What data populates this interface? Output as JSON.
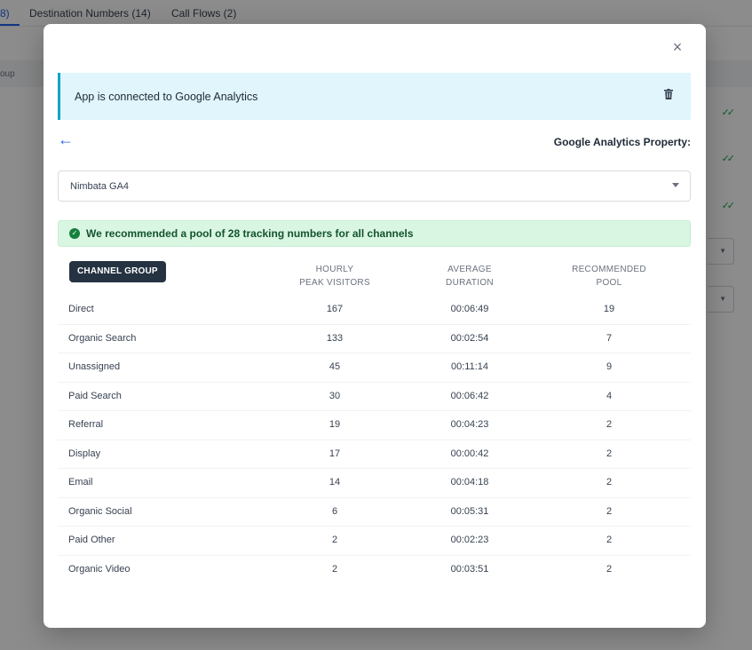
{
  "background": {
    "tabs": [
      {
        "label": "8)"
      },
      {
        "label": "Destination Numbers (14)"
      },
      {
        "label": "Call Flows (2)"
      }
    ],
    "column_fragment": "oup"
  },
  "modal": {
    "close_label": "×",
    "alert_text": "App is connected to Google Analytics",
    "back_label": "←",
    "property_label": "Google Analytics Property:",
    "property_value": "Nimbata GA4",
    "recommendation_text": "We recommended a pool of 28 tracking numbers for all channels",
    "table": {
      "headers": {
        "channel_group": "CHANNEL GROUP",
        "hourly_line1": "HOURLY",
        "hourly_line2": "PEAK VISITORS",
        "duration_line1": "AVERAGE",
        "duration_line2": "DURATION",
        "pool_line1": "RECOMMENDED",
        "pool_line2": "POOL"
      },
      "rows": [
        {
          "channel": "Direct",
          "visitors": "167",
          "duration": "00:06:49",
          "pool": "19"
        },
        {
          "channel": "Organic Search",
          "visitors": "133",
          "duration": "00:02:54",
          "pool": "7"
        },
        {
          "channel": "Unassigned",
          "visitors": "45",
          "duration": "00:11:14",
          "pool": "9"
        },
        {
          "channel": "Paid Search",
          "visitors": "30",
          "duration": "00:06:42",
          "pool": "4"
        },
        {
          "channel": "Referral",
          "visitors": "19",
          "duration": "00:04:23",
          "pool": "2"
        },
        {
          "channel": "Display",
          "visitors": "17",
          "duration": "00:00:42",
          "pool": "2"
        },
        {
          "channel": "Email",
          "visitors": "14",
          "duration": "00:04:18",
          "pool": "2"
        },
        {
          "channel": "Organic Social",
          "visitors": "6",
          "duration": "00:05:31",
          "pool": "2"
        },
        {
          "channel": "Paid Other",
          "visitors": "2",
          "duration": "00:02:23",
          "pool": "2"
        },
        {
          "channel": "Organic Video",
          "visitors": "2",
          "duration": "00:03:51",
          "pool": "2"
        }
      ]
    }
  },
  "icons": {
    "close": "close-icon",
    "trash": "trash-icon",
    "back": "arrow-left-icon",
    "caret": "chevron-down-icon",
    "check": "check-circle-icon"
  },
  "colors": {
    "info_bg": "#e0f5fc",
    "info_border": "#12a4c4",
    "success_bg": "#d9f6e3",
    "success_text": "#14532d",
    "chip_bg": "#253241",
    "link": "#2563eb"
  }
}
